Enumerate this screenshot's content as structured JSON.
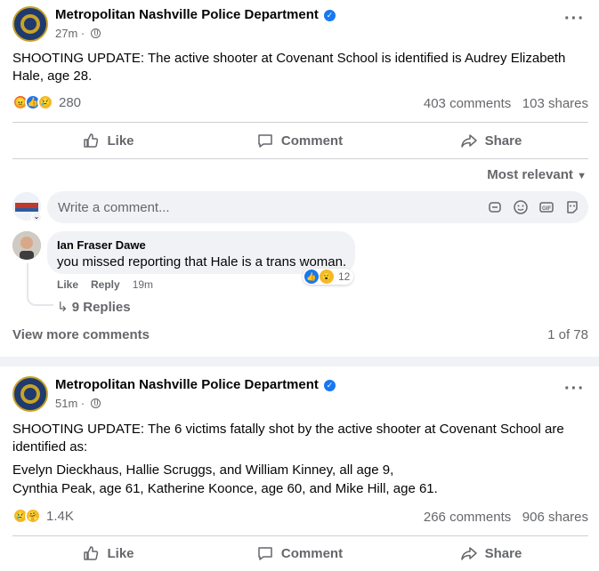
{
  "colors": {
    "brand_blue": "#1877f2",
    "muted": "#65676b",
    "text": "#050505",
    "bg": "#f0f2f5"
  },
  "post1": {
    "page_name": "Metropolitan Nashville Police Department",
    "time": "27m",
    "text": "SHOOTING UPDATE: The active shooter at Covenant School is identified is Audrey Elizabeth Hale, age 28.",
    "reactions": [
      "angry",
      "like",
      "sad"
    ],
    "reaction_count": "280",
    "comments": "403 comments",
    "shares": "103 shares",
    "actions": {
      "like": "Like",
      "comment": "Comment",
      "share": "Share"
    },
    "sort_label": "Most relevant",
    "comment_placeholder": "Write a comment...",
    "comment_box_icons": [
      "sticker-icon",
      "emoji-icon",
      "gif-icon",
      "avatar-sticker-icon"
    ],
    "comment": {
      "author": "Ian Fraser Dawe",
      "text": "you missed reporting that Hale is a trans woman.",
      "actions": {
        "like": "Like",
        "reply": "Reply",
        "time": "19m"
      },
      "reactions": [
        "like",
        "wow"
      ],
      "reaction_count": "12",
      "replies": "9 Replies"
    },
    "view_more": "View more comments",
    "pager": "1 of 78"
  },
  "post2": {
    "page_name": "Metropolitan Nashville Police Department",
    "time": "51m",
    "text_line1": "SHOOTING UPDATE: The 6 victims fatally shot by the active shooter at Covenant School are identified as:",
    "text_line2": "Evelyn Dieckhaus, Hallie Scruggs, and William Kinney, all age 9,",
    "text_line3": "Cynthia Peak, age 61, Katherine Koonce, age 60, and Mike Hill, age 61.",
    "reactions": [
      "sad",
      "care"
    ],
    "reaction_count": "1.4K",
    "comments": "266 comments",
    "shares": "906 shares",
    "actions": {
      "like": "Like",
      "comment": "Comment",
      "share": "Share"
    }
  }
}
